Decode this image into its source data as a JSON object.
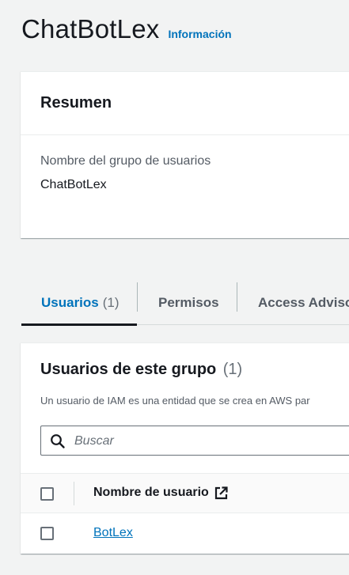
{
  "header": {
    "title": "ChatBotLex",
    "info_link": "Información"
  },
  "summary": {
    "title": "Resumen",
    "group_name_label": "Nombre del grupo de usuarios",
    "group_name_value": "ChatBotLex"
  },
  "tabs": [
    {
      "label": "Usuarios",
      "count": "(1)",
      "active": true
    },
    {
      "label": "Permisos",
      "count": "",
      "active": false
    },
    {
      "label": "Access Advisor",
      "count": "",
      "active": false
    }
  ],
  "users_section": {
    "title": "Usuarios de este grupo",
    "count": "(1)",
    "description": "Un usuario de IAM es una entidad que se crea en AWS par",
    "search_placeholder": "Buscar",
    "search_value": "",
    "column_user_name": "Nombre de usuario",
    "rows": [
      {
        "user_name": "BotLex"
      }
    ]
  },
  "icons": {
    "search": "search-icon",
    "external_link": "external-link-icon"
  },
  "colors": {
    "link": "#0073bb",
    "background": "#f2f3f3",
    "active_tab_underline": "#16191f"
  }
}
